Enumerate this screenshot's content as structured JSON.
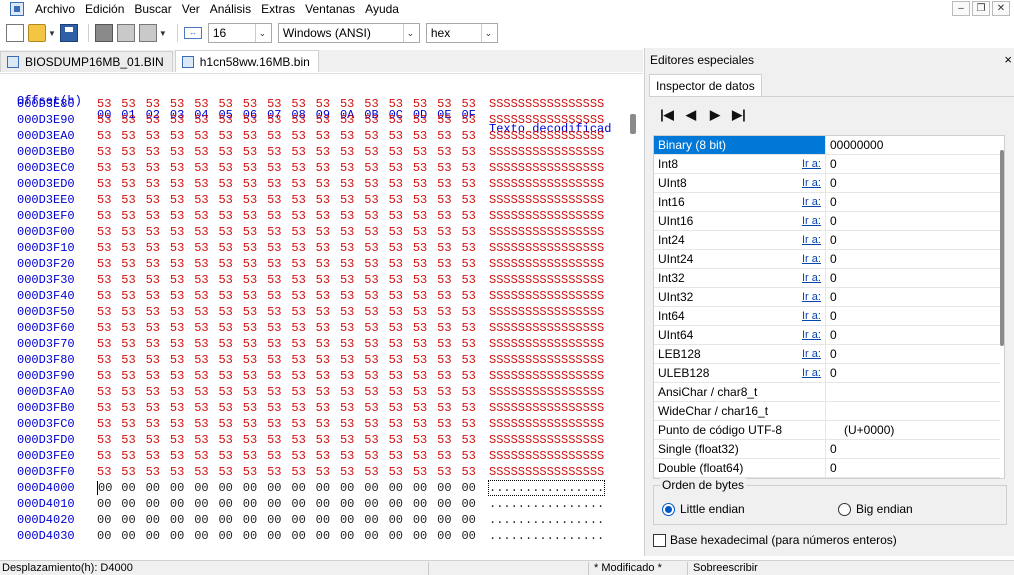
{
  "menu": [
    "Archivo",
    "Edición",
    "Buscar",
    "Ver",
    "Análisis",
    "Extras",
    "Ventanas",
    "Ayuda"
  ],
  "toolbar": {
    "bytes_per_row": "16",
    "charset": "Windows (ANSI)",
    "display_mode": "hex"
  },
  "tabs": [
    {
      "label": "BIOSDUMP16MB_01.BIN",
      "active": false
    },
    {
      "label": "h1cn58ww.16MB.bin",
      "active": true
    }
  ],
  "hex": {
    "header_offset": "Offset(h)",
    "header_columns": [
      "00",
      "01",
      "02",
      "03",
      "04",
      "05",
      "06",
      "07",
      "08",
      "09",
      "0A",
      "0B",
      "0C",
      "0D",
      "0E",
      "0F"
    ],
    "header_text": "Texto decodificad",
    "rows": [
      {
        "offset": "000D3E80",
        "byte": "53",
        "text": "SSSSSSSSSSSSSSSS"
      },
      {
        "offset": "000D3E90",
        "byte": "53",
        "text": "SSSSSSSSSSSSSSSS"
      },
      {
        "offset": "000D3EA0",
        "byte": "53",
        "text": "SSSSSSSSSSSSSSSS"
      },
      {
        "offset": "000D3EB0",
        "byte": "53",
        "text": "SSSSSSSSSSSSSSSS"
      },
      {
        "offset": "000D3EC0",
        "byte": "53",
        "text": "SSSSSSSSSSSSSSSS"
      },
      {
        "offset": "000D3ED0",
        "byte": "53",
        "text": "SSSSSSSSSSSSSSSS"
      },
      {
        "offset": "000D3EE0",
        "byte": "53",
        "text": "SSSSSSSSSSSSSSSS"
      },
      {
        "offset": "000D3EF0",
        "byte": "53",
        "text": "SSSSSSSSSSSSSSSS"
      },
      {
        "offset": "000D3F00",
        "byte": "53",
        "text": "SSSSSSSSSSSSSSSS"
      },
      {
        "offset": "000D3F10",
        "byte": "53",
        "text": "SSSSSSSSSSSSSSSS"
      },
      {
        "offset": "000D3F20",
        "byte": "53",
        "text": "SSSSSSSSSSSSSSSS"
      },
      {
        "offset": "000D3F30",
        "byte": "53",
        "text": "SSSSSSSSSSSSSSSS"
      },
      {
        "offset": "000D3F40",
        "byte": "53",
        "text": "SSSSSSSSSSSSSSSS"
      },
      {
        "offset": "000D3F50",
        "byte": "53",
        "text": "SSSSSSSSSSSSSSSS"
      },
      {
        "offset": "000D3F60",
        "byte": "53",
        "text": "SSSSSSSSSSSSSSSS"
      },
      {
        "offset": "000D3F70",
        "byte": "53",
        "text": "SSSSSSSSSSSSSSSS"
      },
      {
        "offset": "000D3F80",
        "byte": "53",
        "text": "SSSSSSSSSSSSSSSS"
      },
      {
        "offset": "000D3F90",
        "byte": "53",
        "text": "SSSSSSSSSSSSSSSS"
      },
      {
        "offset": "000D3FA0",
        "byte": "53",
        "text": "SSSSSSSSSSSSSSSS"
      },
      {
        "offset": "000D3FB0",
        "byte": "53",
        "text": "SSSSSSSSSSSSSSSS"
      },
      {
        "offset": "000D3FC0",
        "byte": "53",
        "text": "SSSSSSSSSSSSSSSS"
      },
      {
        "offset": "000D3FD0",
        "byte": "53",
        "text": "SSSSSSSSSSSSSSSS"
      },
      {
        "offset": "000D3FE0",
        "byte": "53",
        "text": "SSSSSSSSSSSSSSSS"
      },
      {
        "offset": "000D3FF0",
        "byte": "53",
        "text": "SSSSSSSSSSSSSSSS"
      },
      {
        "offset": "000D4000",
        "byte": "00",
        "text": "................",
        "caret": true
      },
      {
        "offset": "000D4010",
        "byte": "00",
        "text": "................"
      },
      {
        "offset": "000D4020",
        "byte": "00",
        "text": "................"
      },
      {
        "offset": "000D4030",
        "byte": "00",
        "text": "................"
      }
    ]
  },
  "panel": {
    "title": "Editores especiales",
    "close": "×",
    "tab": "Inspector de datos",
    "link_label": "Ir a:",
    "rows": [
      {
        "name": "Binary (8 bit)",
        "value": "00000000",
        "link": false,
        "selected": true
      },
      {
        "name": "Int8",
        "value": "0",
        "link": true
      },
      {
        "name": "UInt8",
        "value": "0",
        "link": true
      },
      {
        "name": "Int16",
        "value": "0",
        "link": true
      },
      {
        "name": "UInt16",
        "value": "0",
        "link": true
      },
      {
        "name": "Int24",
        "value": "0",
        "link": true
      },
      {
        "name": "UInt24",
        "value": "0",
        "link": true
      },
      {
        "name": "Int32",
        "value": "0",
        "link": true
      },
      {
        "name": "UInt32",
        "value": "0",
        "link": true
      },
      {
        "name": "Int64",
        "value": "0",
        "link": true
      },
      {
        "name": "UInt64",
        "value": "0",
        "link": true
      },
      {
        "name": "LEB128",
        "value": "0",
        "link": true
      },
      {
        "name": "ULEB128",
        "value": "0",
        "link": true
      },
      {
        "name": "AnsiChar / char8_t",
        "value": "",
        "link": false
      },
      {
        "name": "WideChar / char16_t",
        "value": "",
        "link": false
      },
      {
        "name": "Punto de código UTF-8",
        "value": "(U+0000)",
        "link": false,
        "indent": true
      },
      {
        "name": "Single (float32)",
        "value": "0",
        "link": false
      },
      {
        "name": "Double (float64)",
        "value": "0",
        "link": false
      }
    ],
    "byte_order_title": "Orden de bytes",
    "little_endian": "Little endian",
    "big_endian": "Big endian",
    "byte_order_selected": "little",
    "hex_base_label": "Base hexadecimal (para números enteros)",
    "hex_base_checked": false
  },
  "status": {
    "offset": "Desplazamiento(h): D4000",
    "modified": "* Modificado *",
    "mode": "Sobreescribir"
  },
  "colors": {
    "offset_blue": "#0000d0",
    "byte_red": "#d01010",
    "selection": "#0078d7"
  }
}
